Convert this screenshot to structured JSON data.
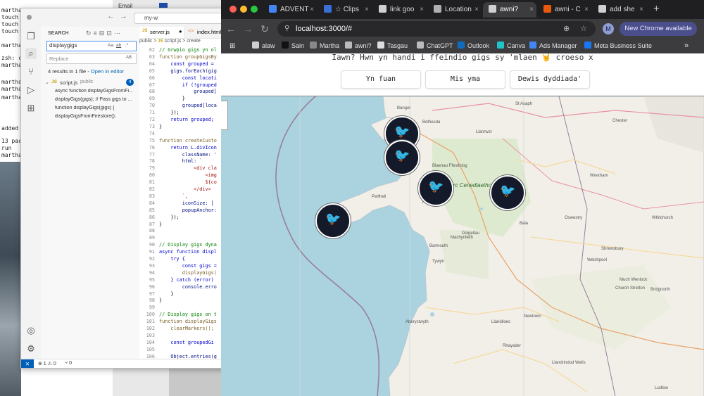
{
  "terminal": {
    "lines": [
      "martha",
      "touch",
      "touch",
      "touch",
      "martha",
      "zsh: c",
      "martha",
      "martha",
      "martha",
      "martha",
      "added",
      "13 pac",
      "run",
      "martha",
      "Server"
    ]
  },
  "background_windows": {
    "tab_label": "Email"
  },
  "vscode": {
    "title_search": "my-w",
    "sidebar": {
      "header": "SEARCH",
      "search_value": "displaygigs",
      "search_options": [
        "Aa",
        "ab",
        ".*"
      ],
      "replace_placeholder": "Replace",
      "replace_option": "AB",
      "summary": "4 results in 1 file",
      "open_in_editor": "Open in editor",
      "file_name": "script.js",
      "file_folder": "public",
      "match_count": "4",
      "results": [
        "async function displayGigsFromFi...",
        "displayGigs(gigs); // Pass gigs to ...",
        "function displayGigs(gigs) {",
        "displayGigsFromFirestore();"
      ]
    },
    "tabs": [
      {
        "label": "server.js",
        "modified": "●"
      },
      {
        "label": "index.html"
      }
    ],
    "breadcrumb": [
      "public",
      ">",
      "script.js",
      ">",
      "create"
    ],
    "code_lines": [
      {
        "n": "62",
        "t": "// Grwpio gigs yn ol",
        "k": "cm"
      },
      {
        "n": "63",
        "t": "function groupGigsBy",
        "k": "fn"
      },
      {
        "n": "64",
        "t": "    const grouped =",
        "k": "kw"
      },
      {
        "n": "65",
        "t": "    gigs.forEach(gig",
        "k": "vr"
      },
      {
        "n": "66",
        "t": "        const locati",
        "k": "kw"
      },
      {
        "n": "67",
        "t": "        if (!grouped",
        "k": "kw"
      },
      {
        "n": "68",
        "t": "            grouped[",
        "k": "vr"
      },
      {
        "n": "69",
        "t": "        }",
        "k": ""
      },
      {
        "n": "70",
        "t": "        grouped[loca",
        "k": "vr"
      },
      {
        "n": "71",
        "t": "    });",
        "k": ""
      },
      {
        "n": "72",
        "t": "    return grouped;",
        "k": "kw"
      },
      {
        "n": "73",
        "t": "}",
        "k": ""
      },
      {
        "n": "74",
        "t": "",
        "k": ""
      },
      {
        "n": "75",
        "t": "function createCusto",
        "k": "fn"
      },
      {
        "n": "76",
        "t": "    return L.divIcon",
        "k": "kw"
      },
      {
        "n": "77",
        "t": "        className: '",
        "k": "vr"
      },
      {
        "n": "78",
        "t": "        html: `",
        "k": "vr"
      },
      {
        "n": "79",
        "t": "            <div cla",
        "k": "st"
      },
      {
        "n": "80",
        "t": "                <img",
        "k": "st"
      },
      {
        "n": "81",
        "t": "                ${co",
        "k": "st"
      },
      {
        "n": "82",
        "t": "            </div>",
        "k": "st"
      },
      {
        "n": "83",
        "t": "        `,",
        "k": "st"
      },
      {
        "n": "84",
        "t": "        iconSize: [",
        "k": "vr"
      },
      {
        "n": "85",
        "t": "        popupAnchor:",
        "k": "vr"
      },
      {
        "n": "86",
        "t": "    });",
        "k": ""
      },
      {
        "n": "87",
        "t": "}",
        "k": ""
      },
      {
        "n": "88",
        "t": "",
        "k": ""
      },
      {
        "n": "89",
        "t": "",
        "k": ""
      },
      {
        "n": "90",
        "t": "// Display gigs dyna",
        "k": "cm"
      },
      {
        "n": "91",
        "t": "async function displ",
        "k": "kw"
      },
      {
        "n": "92",
        "t": "    try {",
        "k": "kw"
      },
      {
        "n": "93",
        "t": "        const gigs =",
        "k": "kw"
      },
      {
        "n": "94",
        "t": "        displayGigs(",
        "k": "fn"
      },
      {
        "n": "95",
        "t": "    } catch (error)",
        "k": "kw"
      },
      {
        "n": "96",
        "t": "        console.erro",
        "k": "vr"
      },
      {
        "n": "97",
        "t": "    }",
        "k": ""
      },
      {
        "n": "98",
        "t": "}",
        "k": ""
      },
      {
        "n": "99",
        "t": "",
        "k": ""
      },
      {
        "n": "100",
        "t": "// Display gigs on t",
        "k": "cm"
      },
      {
        "n": "101",
        "t": "function displayGigs",
        "k": "fn"
      },
      {
        "n": "102",
        "t": "    clearMarkers();",
        "k": "fn"
      },
      {
        "n": "103",
        "t": "",
        "k": ""
      },
      {
        "n": "104",
        "t": "    const groupedGi",
        "k": "kw"
      },
      {
        "n": "105",
        "t": "",
        "k": ""
      },
      {
        "n": "106",
        "t": "    Object.entries(g",
        "k": "vr"
      }
    ],
    "status": {
      "errors": "⊗ 1 ⚠ 0",
      "ports": "⑂ 0"
    }
  },
  "chrome": {
    "tabs": [
      {
        "label": "ADVENT",
        "color": "#4285f4"
      },
      {
        "label": "☆ Clips",
        "color": "#3b6fd8"
      },
      {
        "label": "link goo",
        "color": "#d0d0d0"
      },
      {
        "label": "Location",
        "color": "#b0b0b0"
      },
      {
        "label": "awni?",
        "color": "#d0d0d0",
        "active": true
      },
      {
        "label": "awni - C",
        "color": "#e8590c"
      },
      {
        "label": "add she",
        "color": "#d0d0d0"
      }
    ],
    "new_tab": "+",
    "url": "localhost:3000/#",
    "avatar_letter": "M",
    "update_button": "New Chrome available",
    "bookmarks": [
      {
        "label": "alaw",
        "color": "#cfcfcf"
      },
      {
        "label": "Sain",
        "color": "#111111"
      },
      {
        "label": "Martha",
        "color": "#888888"
      },
      {
        "label": "awni?",
        "color": "#bbbbbb"
      },
      {
        "label": "Tasgau",
        "color": "#dddddd"
      },
      {
        "label": "ChatGPT",
        "color": "#bbbbbb"
      },
      {
        "label": "Outlook",
        "color": "#0f6cbd"
      },
      {
        "label": "Canva",
        "color": "#20c4cb"
      },
      {
        "label": "Ads Manager",
        "color": "#4285f4"
      },
      {
        "label": "Meta Business Suite",
        "color": "#1877f2"
      }
    ],
    "bookmarks_more": "»"
  },
  "page": {
    "heading": "Iawn? Hwn yn handi i ffeindio gigs sy 'mlaen 🤘 croeso x",
    "filters": [
      "Yn fuan",
      "Mis yma",
      "Dewis dyddiada'"
    ],
    "map": {
      "labels": [
        "St Asaph",
        "Chester",
        "Bangor",
        "Bethesda",
        "Llanrwst",
        "Wrexham",
        "Blaenau Ffestiniog",
        "Parc Cenedlaethol Eryri",
        "Pwllheli",
        "Whitchurch",
        "Welshpool",
        "Aberystwyth",
        "Llanidloes",
        "Church Stretton",
        "Bridgnorth",
        "Newtown",
        "Rhayader",
        "Llandrindod Wells",
        "Ludlow",
        "Much Wenlock",
        "Machynlleth",
        "Tywyn",
        "Barmouth",
        "Harlech",
        "Dolgellau",
        "Bala",
        "Oswestry",
        "Shrewsbury"
      ],
      "markers": 5
    }
  }
}
